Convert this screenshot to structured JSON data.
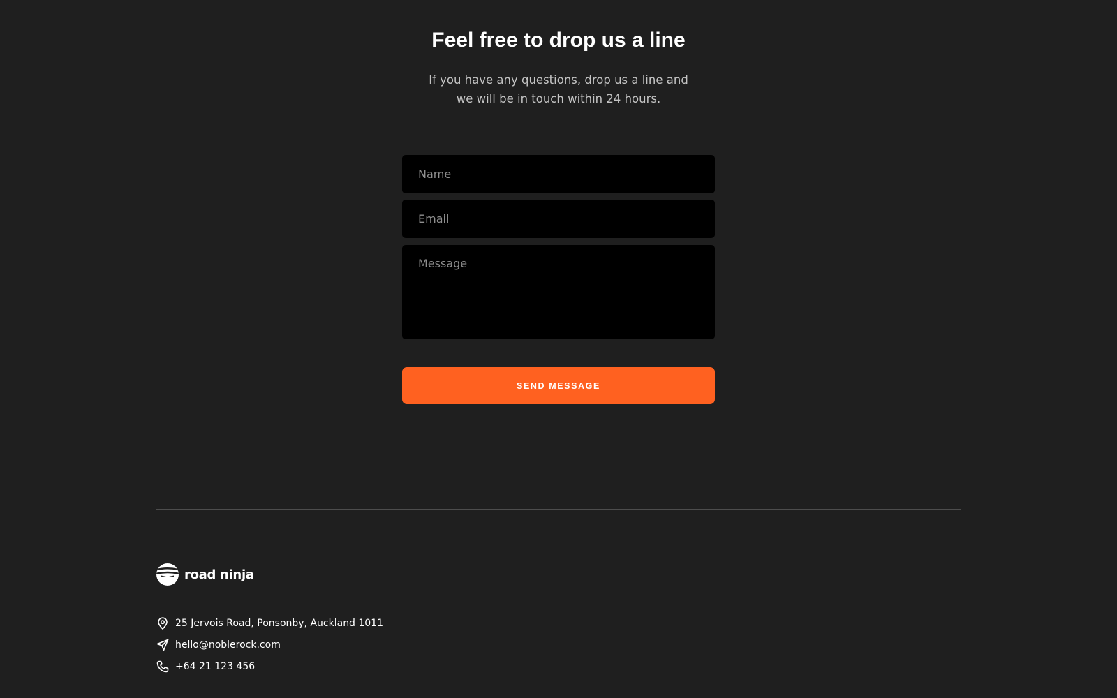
{
  "contact": {
    "title": "Feel free to drop us a line",
    "subtitle_line1": "If you have any questions, drop us a line and",
    "subtitle_line2": "we will be in touch within 24 hours.",
    "form": {
      "name_placeholder": "Name",
      "email_placeholder": "Email",
      "message_placeholder": "Message",
      "submit_label": "SEND MESSAGE"
    }
  },
  "footer": {
    "brand": "road ninja",
    "address": "25 Jervois Road, Ponsonby, Auckland 1011",
    "email": "hello@noblerock.com",
    "phone": "+64 21 123 456",
    "icons": {
      "logo": "ninja-head-logo",
      "address": "map-pin-icon",
      "email": "send-icon",
      "phone": "phone-icon"
    }
  },
  "colors": {
    "background": "#1f1f1f",
    "field_background": "#000000",
    "accent": "#ff6120",
    "divider": "#4d4d4d",
    "muted_text": "#c4c4c4"
  }
}
